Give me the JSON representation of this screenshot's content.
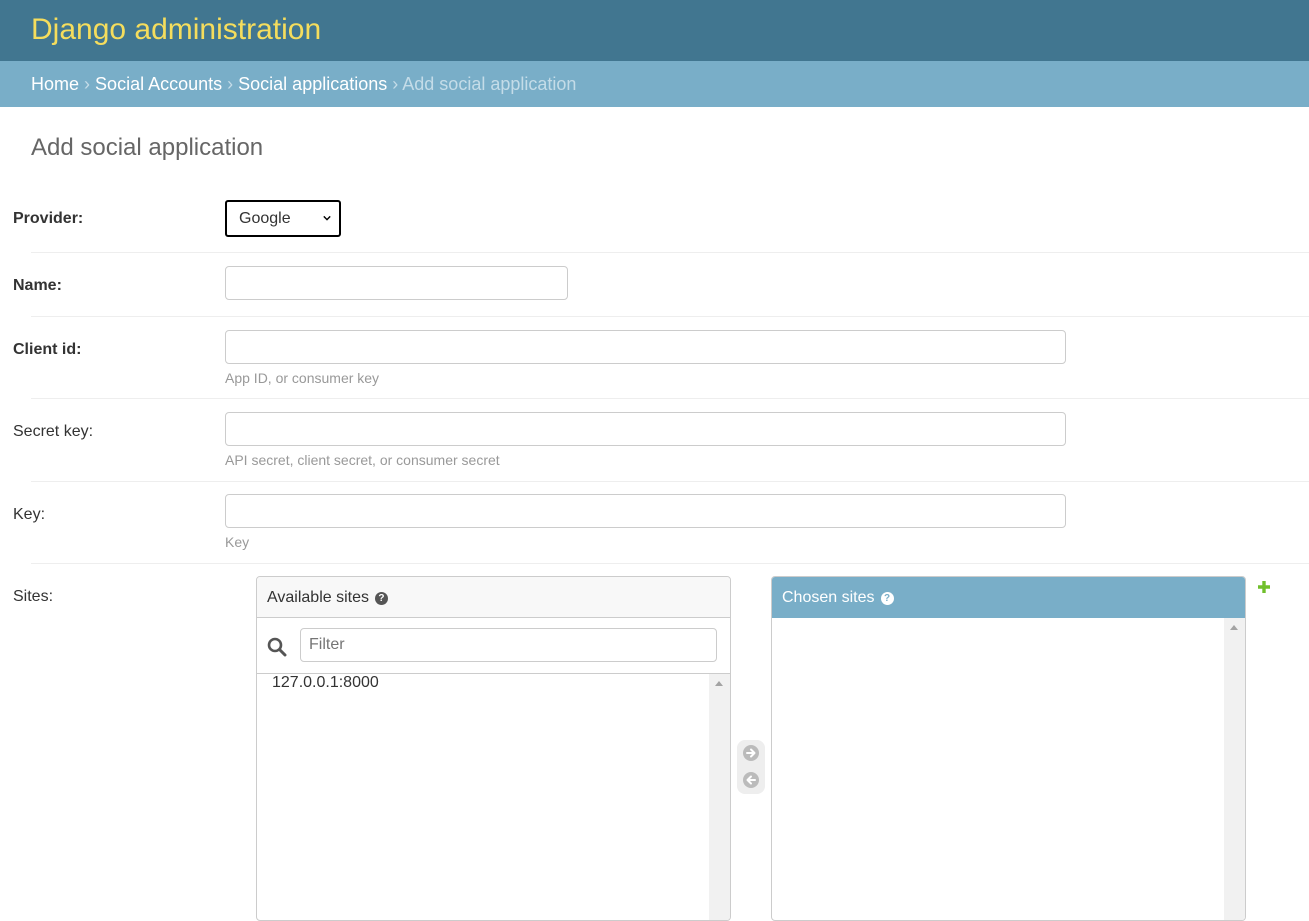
{
  "header": {
    "site_name": "Django administration"
  },
  "breadcrumbs": {
    "home": "Home",
    "app": "Social Accounts",
    "model": "Social applications",
    "current": "Add social application",
    "separator": "›"
  },
  "page_title": "Add social application",
  "form": {
    "provider": {
      "label": "Provider:",
      "value": "Google"
    },
    "name": {
      "label": "Name:",
      "value": ""
    },
    "client_id": {
      "label": "Client id:",
      "value": "",
      "help": "App ID, or consumer key"
    },
    "secret": {
      "label": "Secret key:",
      "value": "",
      "help": "API secret, client secret, or consumer secret"
    },
    "key": {
      "label": "Key:",
      "value": "",
      "help": "Key"
    },
    "sites": {
      "label": "Sites:",
      "available_title": "Available sites",
      "chosen_title": "Chosen sites",
      "help_glyph": "?",
      "filter_placeholder": "Filter",
      "available_options": [
        "127.0.0.1:8000"
      ],
      "chosen_options": []
    }
  },
  "colors": {
    "header_bg": "#417690",
    "branding": "#f5dd5d",
    "breadcrumbs_bg": "#79aec8",
    "add_icon": "#70bf2b"
  },
  "icons": {
    "search": "search-icon",
    "add": "plus-icon",
    "move_right": "arrow-right-circle-icon",
    "move_left": "arrow-left-circle-icon",
    "help": "question-circle-icon",
    "dropdown": "chevron-down-icon"
  }
}
